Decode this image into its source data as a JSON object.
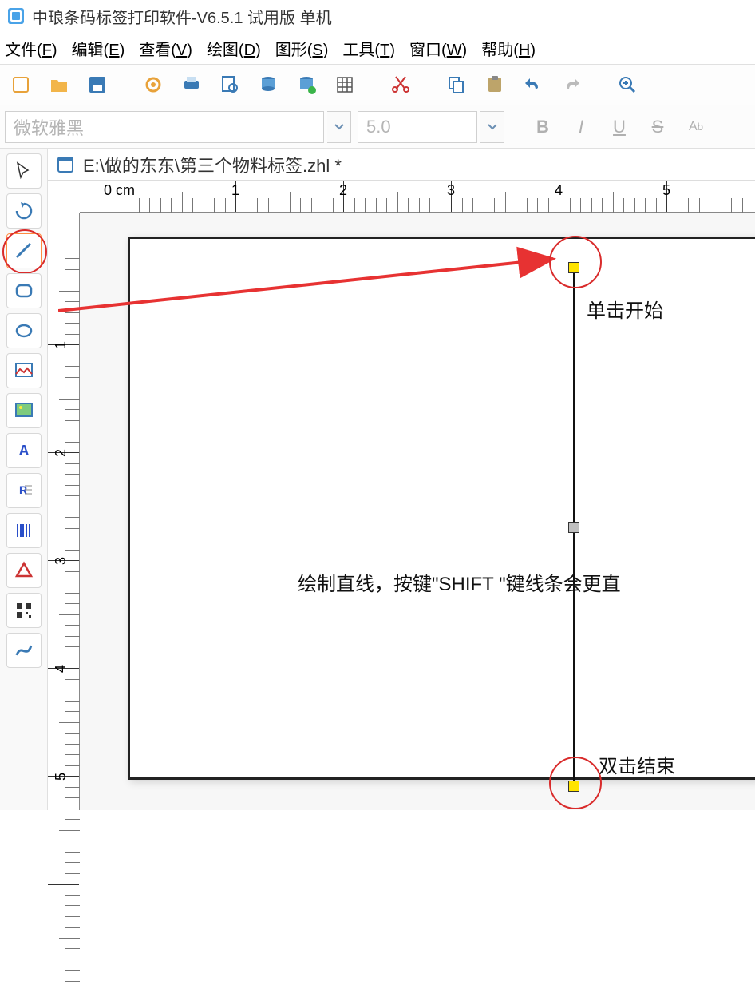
{
  "titlebar": {
    "title": "中琅条码标签打印软件-V6.5.1 试用版 单机"
  },
  "menubar": {
    "items": [
      {
        "label": "文件",
        "accel": "F"
      },
      {
        "label": "编辑",
        "accel": "E"
      },
      {
        "label": "查看",
        "accel": "V"
      },
      {
        "label": "绘图",
        "accel": "D"
      },
      {
        "label": "图形",
        "accel": "S"
      },
      {
        "label": "工具",
        "accel": "T"
      },
      {
        "label": "窗口",
        "accel": "W"
      },
      {
        "label": "帮助",
        "accel": "H"
      }
    ]
  },
  "toolbar1": {
    "icons": [
      "new-icon",
      "open-icon",
      "save-icon",
      "settings-gear-icon",
      "print-icon",
      "print-preview-icon",
      "database-icon",
      "database-add-icon",
      "grid-icon",
      "cut-icon",
      "copy-icon",
      "paste-icon",
      "undo-icon",
      "redo-icon",
      "zoom-in-icon"
    ]
  },
  "toolbar2": {
    "font_placeholder": "微软雅黑",
    "fontsize_placeholder": "5.0",
    "format_buttons": {
      "bold": "B",
      "italic": "I",
      "underline": "U",
      "strike": "S",
      "super": "A"
    }
  },
  "side_tools": [
    {
      "name": "select-tool-icon"
    },
    {
      "name": "rotate-tool-icon"
    },
    {
      "name": "line-tool-icon",
      "selected": true,
      "circled": true
    },
    {
      "name": "rounded-rect-tool-icon"
    },
    {
      "name": "ellipse-tool-icon"
    },
    {
      "name": "image-tool-icon"
    },
    {
      "name": "picture-tool-icon"
    },
    {
      "name": "text-tool-icon",
      "label": "A"
    },
    {
      "name": "richtext-tool-icon",
      "label": "R"
    },
    {
      "name": "barcode-tool-icon"
    },
    {
      "name": "triangle-tool-icon"
    },
    {
      "name": "qrcode-tool-icon"
    },
    {
      "name": "curve-tool-icon"
    }
  ],
  "document": {
    "path": "E:\\做的东东\\第三个物料标签.zhl *"
  },
  "ruler": {
    "unit": "0 cm",
    "h_labels": [
      "1",
      "2",
      "3",
      "4",
      "5"
    ],
    "v_labels": [
      "1",
      "2",
      "3",
      "4",
      "5"
    ]
  },
  "annotations": {
    "start_click": "单击开始",
    "shift_hint": "绘制直线，按键\"SHIFT \"键线条会更直",
    "end_dblclick": "双击结束"
  }
}
